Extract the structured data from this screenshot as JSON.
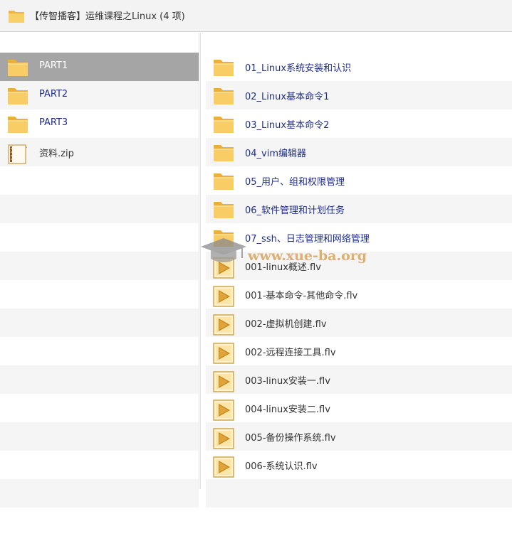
{
  "window": {
    "title": "【传智播客】运维课程之Linux (4 项)"
  },
  "left_pane": {
    "items": [
      {
        "label": "PART1",
        "type": "folder",
        "selected": true
      },
      {
        "label": "PART2",
        "type": "folder",
        "selected": false
      },
      {
        "label": "PART3",
        "type": "folder",
        "selected": false
      },
      {
        "label": "资料.zip",
        "type": "zip",
        "selected": false
      }
    ]
  },
  "right_pane": {
    "items": [
      {
        "label": "01_Linux系统安装和认识",
        "type": "folder"
      },
      {
        "label": "02_Linux基本命令1",
        "type": "folder"
      },
      {
        "label": "03_Linux基本命令2",
        "type": "folder"
      },
      {
        "label": "04_vim编辑器",
        "type": "folder"
      },
      {
        "label": "05_用户、组和权限管理",
        "type": "folder"
      },
      {
        "label": "06_软件管理和计划任务",
        "type": "folder"
      },
      {
        "label": "07_ssh、日志管理和网络管理",
        "type": "folder"
      },
      {
        "label": "001-linux概述.flv",
        "type": "video"
      },
      {
        "label": "001-基本命令-其他命令.flv",
        "type": "video"
      },
      {
        "label": "002-虚拟机创建.flv",
        "type": "video"
      },
      {
        "label": "002-远程连接工具.flv",
        "type": "video"
      },
      {
        "label": "003-linux安装一.flv",
        "type": "video"
      },
      {
        "label": "004-linux安装二.flv",
        "type": "video"
      },
      {
        "label": "005-备份操作系统.flv",
        "type": "video"
      },
      {
        "label": "006-系统认识.flv",
        "type": "video"
      }
    ]
  },
  "watermark": {
    "text": "www.xue-ba.org"
  },
  "colors": {
    "folder_link": "#1f2e8c",
    "selection": "#a5a5a5",
    "folder_icon": "#f7c65b",
    "video_icon": "#d7a23a"
  }
}
